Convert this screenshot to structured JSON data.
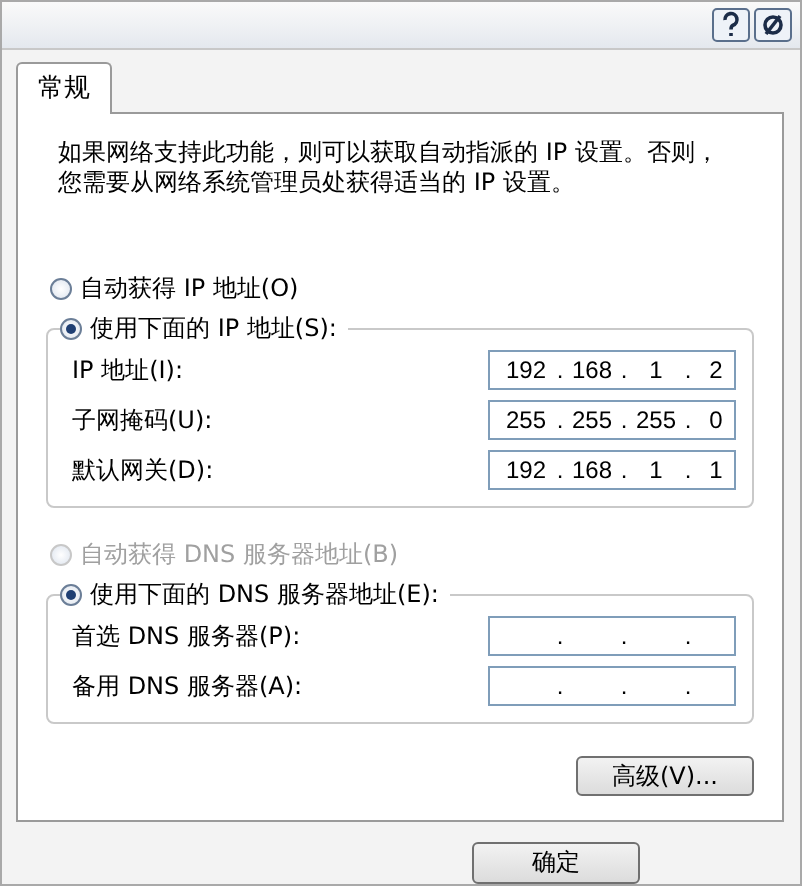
{
  "tabs": [
    {
      "label": "常规",
      "selected": true
    }
  ],
  "intro": "如果网络支持此功能，则可以获取自动指派的 IP 设置。否则，您需要从网络系统管理员处获得适当的 IP 设置。",
  "sections": [
    {
      "auto": {
        "label": "自动获得 IP 地址(O)",
        "selected": false,
        "disabled": false
      },
      "manual": {
        "label": "使用下面的 IP 地址(S):",
        "selected": true
      },
      "fields": [
        {
          "label": "IP 地址(I):",
          "octets": [
            "192",
            "168",
            "1",
            "2"
          ],
          "dots": [
            ".",
            ".",
            "."
          ]
        },
        {
          "label": "子网掩码(U):",
          "octets": [
            "255",
            "255",
            "255",
            "0"
          ],
          "dots": [
            ".",
            ".",
            "."
          ]
        },
        {
          "label": "默认网关(D):",
          "octets": [
            "192",
            "168",
            "1",
            "1"
          ],
          "dots": [
            ".",
            ".",
            "."
          ]
        }
      ]
    },
    {
      "auto": {
        "label": "自动获得 DNS 服务器地址(B)",
        "selected": false,
        "disabled": true
      },
      "manual": {
        "label": "使用下面的 DNS 服务器地址(E):",
        "selected": true
      },
      "fields": [
        {
          "label": "首选 DNS 服务器(P):",
          "dots": [
            ".",
            ".",
            "."
          ]
        },
        {
          "label": "备用 DNS 服务器(A):",
          "dots": [
            ".",
            ".",
            "."
          ]
        }
      ]
    }
  ],
  "advanced_button": "高级(V)...",
  "buttons": [
    "确定"
  ]
}
